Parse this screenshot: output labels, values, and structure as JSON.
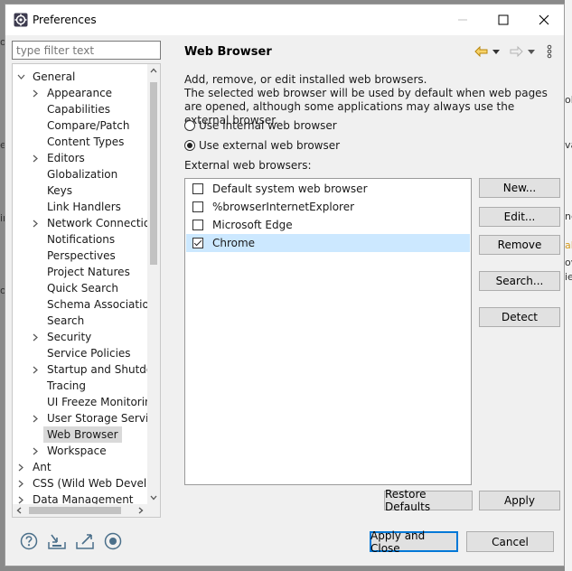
{
  "window": {
    "title": "Preferences"
  },
  "filter": {
    "placeholder": "type filter text"
  },
  "tree": [
    {
      "label": "General",
      "level": 0,
      "expander": "expanded"
    },
    {
      "label": "Appearance",
      "level": 1,
      "expander": "collapsed"
    },
    {
      "label": "Capabilities",
      "level": 1,
      "expander": "none"
    },
    {
      "label": "Compare/Patch",
      "level": 1,
      "expander": "none"
    },
    {
      "label": "Content Types",
      "level": 1,
      "expander": "none"
    },
    {
      "label": "Editors",
      "level": 1,
      "expander": "collapsed"
    },
    {
      "label": "Globalization",
      "level": 1,
      "expander": "none"
    },
    {
      "label": "Keys",
      "level": 1,
      "expander": "none"
    },
    {
      "label": "Link Handlers",
      "level": 1,
      "expander": "none"
    },
    {
      "label": "Network Connection",
      "level": 1,
      "expander": "collapsed"
    },
    {
      "label": "Notifications",
      "level": 1,
      "expander": "none"
    },
    {
      "label": "Perspectives",
      "level": 1,
      "expander": "none"
    },
    {
      "label": "Project Natures",
      "level": 1,
      "expander": "none"
    },
    {
      "label": "Quick Search",
      "level": 1,
      "expander": "none"
    },
    {
      "label": "Schema Associations",
      "level": 1,
      "expander": "none"
    },
    {
      "label": "Search",
      "level": 1,
      "expander": "none"
    },
    {
      "label": "Security",
      "level": 1,
      "expander": "collapsed"
    },
    {
      "label": "Service Policies",
      "level": 1,
      "expander": "none"
    },
    {
      "label": "Startup and Shutdown",
      "level": 1,
      "expander": "collapsed"
    },
    {
      "label": "Tracing",
      "level": 1,
      "expander": "none"
    },
    {
      "label": "UI Freeze Monitoring",
      "level": 1,
      "expander": "none"
    },
    {
      "label": "User Storage Service",
      "level": 1,
      "expander": "collapsed"
    },
    {
      "label": "Web Browser",
      "level": 1,
      "expander": "none",
      "selected": true
    },
    {
      "label": "Workspace",
      "level": 1,
      "expander": "collapsed"
    },
    {
      "label": "Ant",
      "level": 0,
      "expander": "collapsed"
    },
    {
      "label": "CSS (Wild Web Developer)",
      "level": 0,
      "expander": "collapsed"
    },
    {
      "label": "Data Management",
      "level": 0,
      "expander": "collapsed"
    }
  ],
  "page": {
    "title": "Web Browser",
    "description_line1": "Add, remove, or edit installed web browsers.",
    "description_line2": "The selected web browser will be used by default when web pages are opened, although some applications may always use the external browser.",
    "radio_internal": "Use internal web browser",
    "radio_external": "Use external web browser",
    "selected_mode": "external",
    "external_label": "External web browsers:"
  },
  "browsers": [
    {
      "name": "Default system web browser",
      "checked": false,
      "selected": false
    },
    {
      "name": "%browserInternetExplorer",
      "checked": false,
      "selected": false
    },
    {
      "name": "Microsoft Edge",
      "checked": false,
      "selected": false
    },
    {
      "name": "Chrome",
      "checked": true,
      "selected": true
    }
  ],
  "buttons": {
    "new": "New...",
    "edit": "Edit...",
    "remove": "Remove",
    "search": "Search...",
    "detect": "Detect",
    "restore_defaults": "Restore Defaults",
    "apply": "Apply",
    "apply_close": "Apply and Close",
    "cancel": "Cancel"
  },
  "colors": {
    "selection": "#cce8ff",
    "accent": "#0078d7",
    "tree_selection": "#d9d9d9",
    "nav_back": "#d59a1e"
  },
  "background_fragments": {
    "left": [
      "o",
      "e",
      "ir",
      "ol"
    ],
    "right": [
      "ol",
      "va",
      "ne",
      "al",
      "ov",
      "ie"
    ]
  }
}
